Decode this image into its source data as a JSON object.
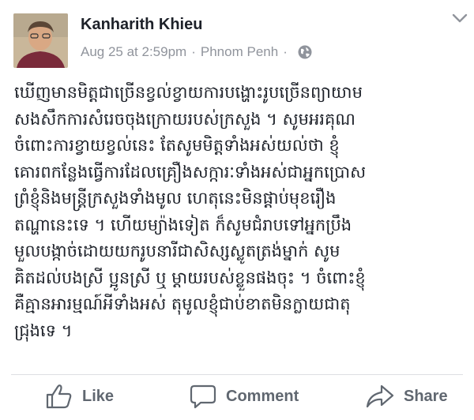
{
  "post": {
    "author": "Kanharith Khieu",
    "date": "Aug 25 at 2:59pm",
    "separator": "·",
    "location": "Phnom Penh",
    "privacy_icon": "globe-icon",
    "menu_icon": "chevron-down-icon",
    "body_lines": [
      "ឃើញមានមិត្តជាច្រើនខ្វល់ខ្វាយការបង្ហោះរូបច្រើនព្យាយាម",
      "សងសឹកការសំរេចចុងក្រោយរបស់ក្រសួង ។ សូមអរគុណ",
      "ចំពោះការខ្វាយខ្វល់នេះ តែសូមមិត្តទាំងអស់យល់ថា ខ្ញុំ",
      "គោរពកន្លែងធ្វើការដែលគ្រឿងសក្ការៈទាំងអស់ជាអ្នកប្រោស",
      "ព្រំខ្ញុំនិងមន្ត្រីក្រសួងទាំងមូល ហេតុនេះមិនផ្តាប់មុខរឿង",
      "តណ្ហានេះទេ ។ ហើយម្យ៉ាងទៀត ក៏សូមជំរាបទៅអ្នកប្រឹង",
      "មួលបង្កាច់ដោយយករូបនារីជាសិស្សស្លូតត្រង់ម្នាក់ សូម",
      "គិតដល់បងស្រី ប្អូនស្រី ឬ ម្តាយរបស់ខ្លួនផងចុះ ។ ចំពោះខ្ញុំ",
      "គឺគ្មានអារម្មណ៍អីទាំងអស់ តុមូលខ្ញុំជាប់ខាតមិនក្លាយជាតុ",
      "ជ្រុងទេ ។"
    ]
  },
  "actions": {
    "like": "Like",
    "comment": "Comment",
    "share": "Share"
  },
  "colors": {
    "meta_gray": "#90949c",
    "action_gray": "#606770",
    "text": "#1d2129"
  }
}
